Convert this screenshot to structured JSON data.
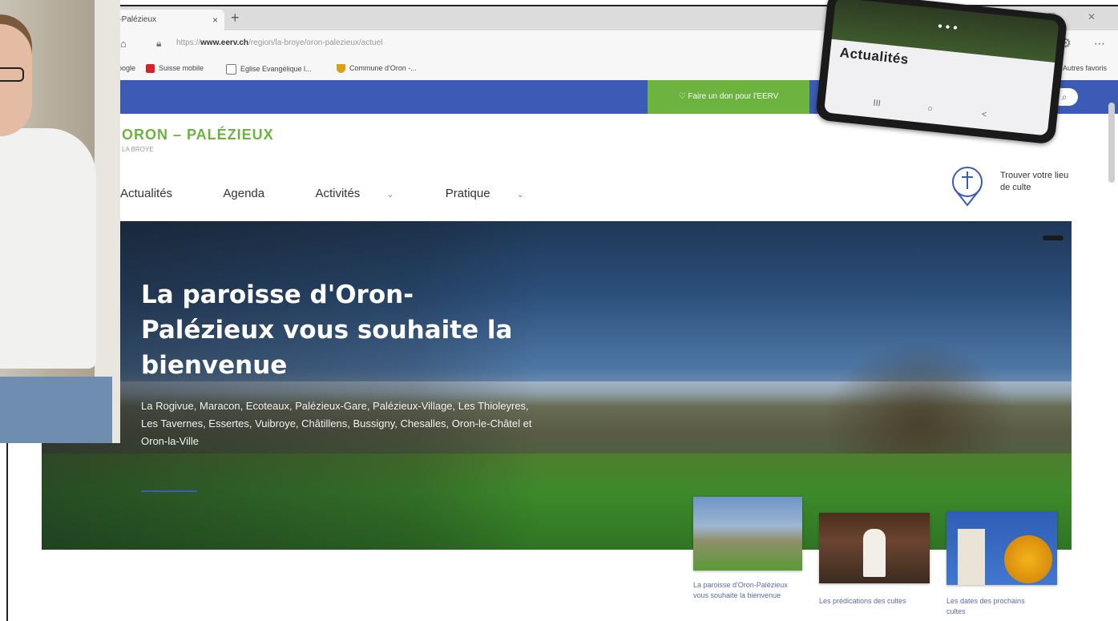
{
  "browser": {
    "tab_title": "...-Palézieux",
    "tab_close": "×",
    "new_tab": "+",
    "url_prefix": "https://",
    "url_domain": "www.eerv.ch",
    "url_path": "/region/la-broye/oron-palezieux/actuel",
    "bookmarks": [
      {
        "label": "Google",
        "color": "#2a6fd6"
      },
      {
        "label": "Suisse mobile",
        "color": "#d4232b"
      },
      {
        "label": "Eglise Evangélique l...",
        "color": "#ffffff"
      },
      {
        "label": "Commune d'Oron -...",
        "color": "#d9a018"
      }
    ],
    "other_favorites": "Autres favoris"
  },
  "site": {
    "donate_label": "Faire un don pour l'EERV",
    "brand": "ORON – PALÉZIEUX",
    "brand_sub": "LA BROYE",
    "nav": [
      {
        "label": "Actualités"
      },
      {
        "label": "Agenda"
      },
      {
        "label": "Activités"
      },
      {
        "label": "Pratique"
      }
    ],
    "finder_label": "Trouver votre lieu de culte",
    "hero_title": "La paroisse d'Oron-Palézieux vous souhaite la bienvenue",
    "hero_text": "La Rogivue, Maracon, Ecoteaux, Palézieux-Gare, Palézieux-Village, Les Thioleyres, Les Tavernes, Essertes, Vuibroye, Châtillens, Bussigny, Chesalles, Oron-le-Châtel et Oron-la-Ville",
    "thumbs": [
      {
        "caption": "La paroisse d'Oron-Palézieux vous souhaite la bienvenue"
      },
      {
        "caption": "Les prédications des cultes"
      },
      {
        "caption": "Les dates des prochains cultes"
      }
    ]
  },
  "phone": {
    "title": "Actualités",
    "nav_recent": "III",
    "nav_home": "○",
    "nav_back": "<",
    "dots": "•••"
  },
  "colors": {
    "accent_blue": "#3b5bb5",
    "accent_green": "#6cb33f"
  }
}
